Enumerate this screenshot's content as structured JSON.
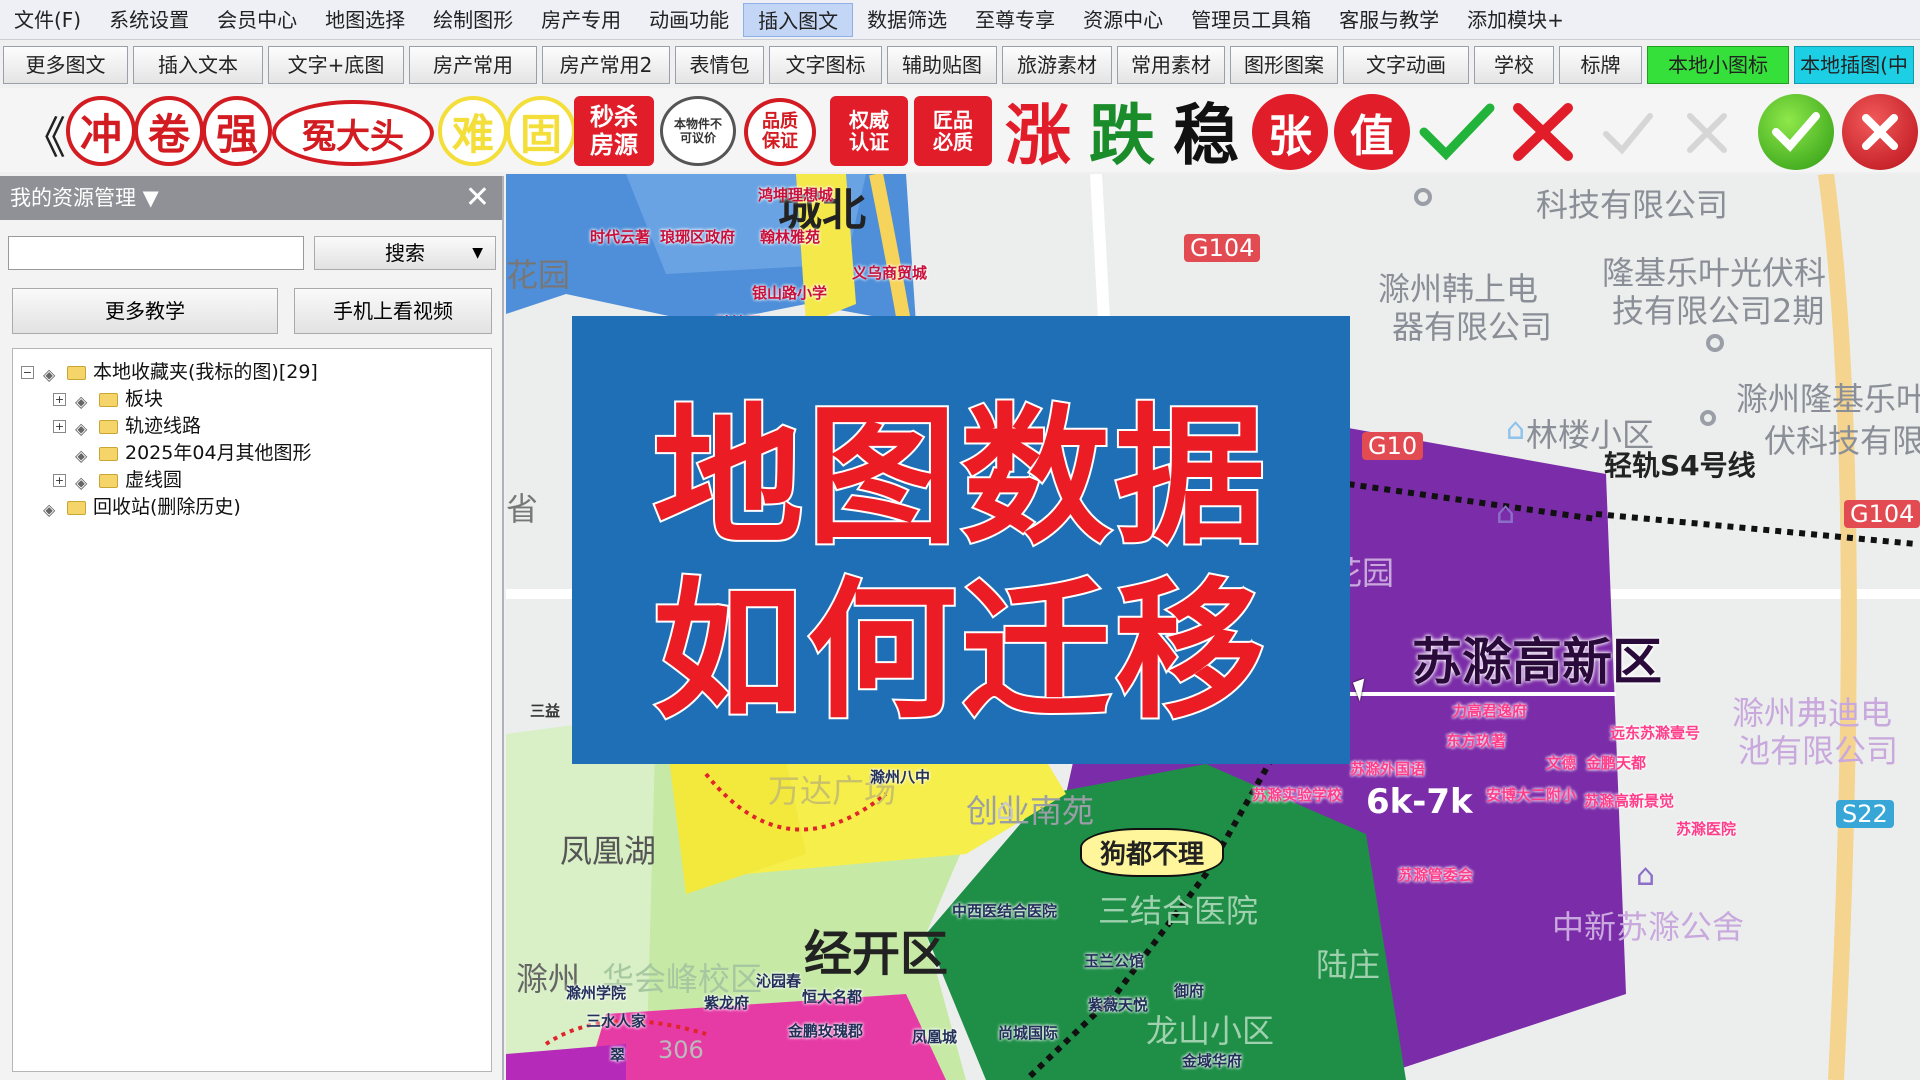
{
  "menubar": {
    "items": [
      "文件(F)",
      "系统设置",
      "会员中心",
      "地图选择",
      "绘制图形",
      "房产专用",
      "动画功能",
      "插入图文",
      "数据筛选",
      "至尊专享",
      "资源中心",
      "管理员工具箱",
      "客服与教学",
      "添加模块+"
    ],
    "active_index": 7
  },
  "toolbar": {
    "tabs": [
      "更多图文",
      "插入文本",
      "文字+底图",
      "房产常用",
      "房产常用2",
      "表情包",
      "文字图标",
      "辅助贴图",
      "旅游素材",
      "常用素材",
      "图形图案",
      "文字动画",
      "学校",
      "标牌",
      "本地小图标",
      "本地插图(中"
    ]
  },
  "stamps": {
    "back": "《",
    "circle1": "冲",
    "circle2": "卷",
    "circle3": "强",
    "oval": "冤大头",
    "yellow1": "难",
    "yellow2": "固",
    "sq1": "秒杀房源",
    "seal1": "本物件不可议价",
    "seal2": "品质保证",
    "sq2": "权威认证",
    "sq3": "匠品必质",
    "big_rise": "涨",
    "big_fall": "跌",
    "big_stable": "稳",
    "rr1": "张",
    "rr2": "值"
  },
  "panel": {
    "title": "我的资源管理 ▼",
    "close": "✕",
    "search_placeholder": "",
    "search_button": "搜索",
    "btn_teaching": "更多教学",
    "btn_mobile": "手机上看视频",
    "tree": [
      {
        "label": "本地收藏夹(我标的图)[29]",
        "level": 0,
        "expander": "−"
      },
      {
        "label": "板块",
        "level": 1,
        "expander": "+"
      },
      {
        "label": "轨迹线路",
        "level": 1,
        "expander": "+"
      },
      {
        "label": "2025年04月其他图形",
        "level": 1,
        "expander": ""
      },
      {
        "label": "虚线圆",
        "level": 1,
        "expander": "+"
      },
      {
        "label": "回收站(删除历史)",
        "level": 0,
        "expander": ""
      }
    ]
  },
  "map": {
    "labels": {
      "chengbei": "城北",
      "tech1": "科技有限公司",
      "tech2a": "隆基乐叶光伏科",
      "tech2b": "技有限公司2期",
      "han1": "滁州韩上电",
      "han2": "器有限公司",
      "linlou": "林楼小区",
      "longji1": "滁州隆基乐叶",
      "longji2": "伏科技有限",
      "s4": "轻轨S4号线",
      "dongsheng": "东升花园",
      "suchu": "苏滁高新区",
      "fudi1": "滁州弗迪电",
      "fudi2": "池有限公司",
      "fenghuang": "凤凰湖",
      "jingkai": "经开区",
      "gouduo": "狗都不理",
      "price": "6k-7k",
      "zhongxin": "中新苏滁公舍",
      "chuangye": "创业南苑",
      "sanjiehe": "三结合医院",
      "huacheng": "华会峰校区",
      "longshan": "龙山小区",
      "luzhuang": "陆庄",
      "wanda": "万达广场",
      "huayuan": "花园",
      "sheng": "省",
      "san": "三益",
      "chu": "滁州",
      "gaoxin_sm": [
        "力高君逸府",
        "东方玖著",
        "远东苏滁壹号",
        "文德",
        "金鹏天都",
        "苏滁外国语",
        "苏滁实验学校",
        "安博大二附小",
        "苏滁高新景觉",
        "苏滁医院",
        "苏滁管委会"
      ],
      "top_sm": [
        "鸿坤理想城",
        "时代云著",
        "琅琊区政府",
        "翰林雅苑",
        "义乌商贸城",
        "银山路小学",
        "碧桂园"
      ],
      "bottom_sm": [
        "滁州八中",
        "中西医结合医院",
        "玉兰公馆",
        "紫薇天悦",
        "御府",
        "金域华府",
        "沁园春",
        "恒大名都",
        "紫龙府",
        "金鹏玫瑰郡",
        "凤凰城",
        "尚城国际",
        "滁州学院",
        "三水人家",
        "翠"
      ]
    },
    "shields": {
      "g104a": "G104",
      "g104b": "G104",
      "g10x": "G10",
      "s22": "S22",
      "n306": "306"
    }
  },
  "overlay": {
    "line1": "地图数据",
    "line2": "如何迁移"
  }
}
